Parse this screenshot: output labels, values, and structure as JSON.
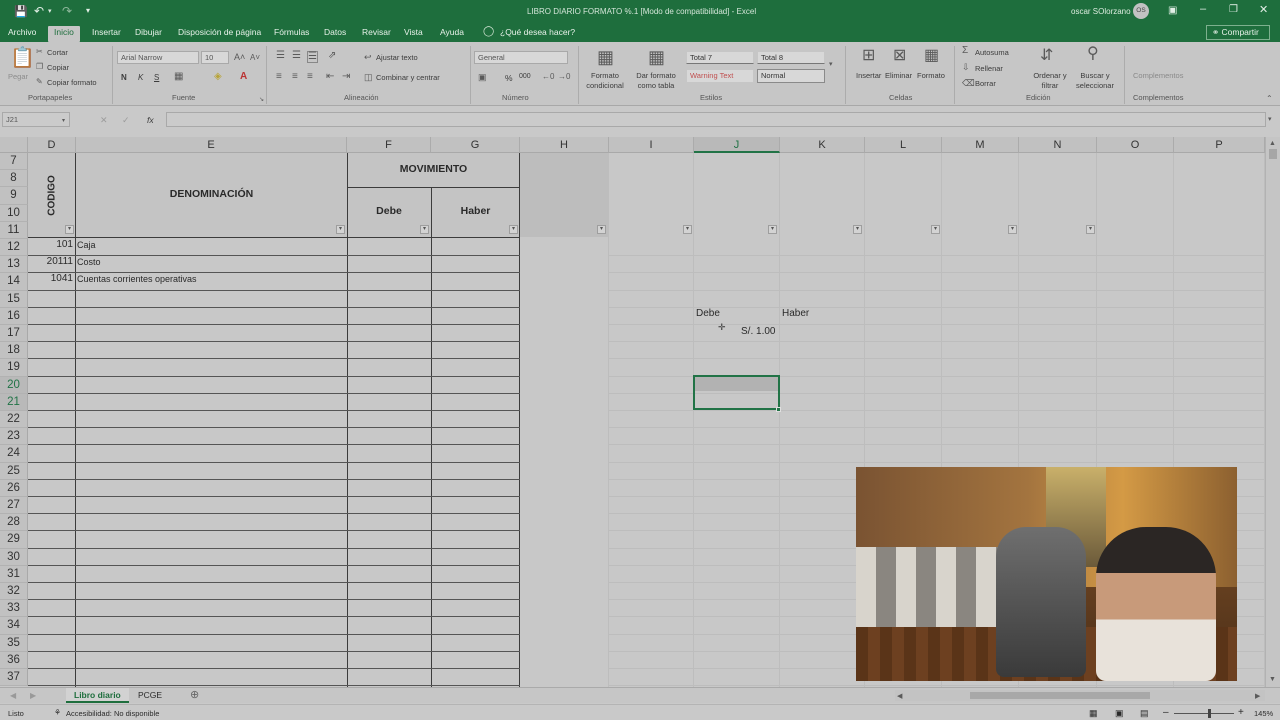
{
  "window": {
    "title": "LIBRO DIARIO FORMATO %.1 [Modo de compatibilidad] - Excel",
    "user": "oscar SOlorzano",
    "avatar_initials": "OS"
  },
  "tabs": [
    "Archivo",
    "Inicio",
    "Insertar",
    "Dibujar",
    "Disposición de página",
    "Fórmulas",
    "Datos",
    "Revisar",
    "Vista",
    "Ayuda"
  ],
  "tell_me": "¿Qué desea hacer?",
  "share_label": "Compartir",
  "ribbon": {
    "clipboard": {
      "paste": "Pegar",
      "cut": "Cortar",
      "copy": "Copiar",
      "format_painter": "Copiar formato",
      "group": "Portapapeles"
    },
    "font": {
      "name": "Arial Narrow",
      "size": "10",
      "bold": "N",
      "italic": "K",
      "underline": "S",
      "group": "Fuente"
    },
    "alignment": {
      "wrap": "Ajustar texto",
      "merge": "Combinar y centrar",
      "group": "Alineación"
    },
    "number": {
      "format": "General",
      "percent": "%",
      "thousands": "000",
      "group": "Número"
    },
    "styles": {
      "conditional": "Formato condicional",
      "as_table": "Dar formato como tabla",
      "total7": "Total 7",
      "total8": "Total 8",
      "warning": "Warning Text",
      "normal": "Normal",
      "group": "Estilos"
    },
    "cells": {
      "insert": "Insertar",
      "delete": "Eliminar",
      "format": "Formato",
      "group": "Celdas"
    },
    "editing": {
      "autosum": "Autosuma",
      "fill": "Rellenar",
      "clear": "Borrar",
      "sort": "Ordenar y filtrar",
      "find": "Buscar y seleccionar",
      "group": "Edición"
    },
    "addins": {
      "label": "Complementos",
      "group": "Complementos"
    }
  },
  "formula_bar": {
    "name_box": "J21",
    "fx": "fx",
    "value": ""
  },
  "columns": [
    "D",
    "E",
    "F",
    "G",
    "H",
    "I",
    "J",
    "K",
    "L",
    "M",
    "N",
    "O",
    "P"
  ],
  "rows": [
    "7",
    "8",
    "9",
    "10",
    "11",
    "12",
    "13",
    "14",
    "15",
    "16",
    "17",
    "18",
    "19",
    "20",
    "21",
    "22",
    "23",
    "24",
    "25",
    "26",
    "27",
    "28",
    "29",
    "30",
    "31",
    "32",
    "33",
    "34",
    "35",
    "36",
    "37"
  ],
  "sheet": {
    "header_codigo": "CODIGO",
    "header_denominacion": "DENOMINACIÓN",
    "header_movimiento": "MOVIMIENTO",
    "header_debe": "Debe",
    "header_haber": "Haber",
    "entries": [
      {
        "code": "101",
        "name": "Caja"
      },
      {
        "code": "20111",
        "name": "Costo"
      },
      {
        "code": "1041",
        "name": "Cuentas corrientes operativas"
      }
    ],
    "side_debe": "Debe",
    "side_haber": "Haber",
    "amount": "S/. 1.00"
  },
  "sheet_tabs": [
    "Libro diario",
    "PCGE"
  ],
  "status": {
    "ready": "Listo",
    "accessibility": "Accesibilidad: No disponible",
    "zoom": "145%"
  },
  "colors": {
    "excel_green": "#1e6e3d",
    "grid_bg": "#c8c8c8",
    "selected_cell": "#217346"
  }
}
